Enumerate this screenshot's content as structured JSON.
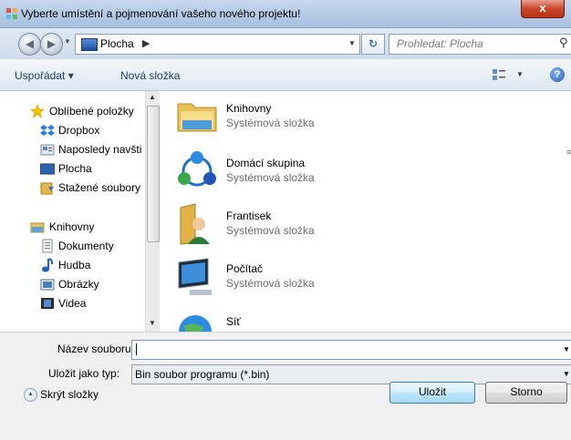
{
  "window": {
    "title": "Vyberte umístění a pojmenování vašeho nového projektu!",
    "close_label": "x"
  },
  "address": {
    "location": "Plocha",
    "search_placeholder": "Prohledat: Plocha"
  },
  "toolbar": {
    "organize_label": "Uspořádat ▾",
    "new_folder_label": "Nová složka"
  },
  "nav": {
    "favorites": [
      {
        "label": "Oblíbené položky",
        "icon": "star-icon"
      },
      {
        "label": "Dropbox",
        "icon": "dropbox-icon"
      },
      {
        "label": "Naposledy navšti",
        "icon": "recent-places-icon"
      },
      {
        "label": "Plocha",
        "icon": "desktop-icon"
      },
      {
        "label": "Stažené soubory",
        "icon": "downloads-icon"
      }
    ],
    "libraries": [
      {
        "label": "Knihovny",
        "icon": "libraries-icon"
      },
      {
        "label": "Dokumenty",
        "icon": "documents-icon"
      },
      {
        "label": "Hudba",
        "icon": "music-icon"
      },
      {
        "label": "Obrázky",
        "icon": "pictures-icon"
      },
      {
        "label": "Videa",
        "icon": "videos-icon"
      }
    ]
  },
  "content": {
    "items": [
      {
        "name": "Knihovny",
        "desc": "Systémová složka",
        "icon": "libraries-folder-icon"
      },
      {
        "name": "Domácí skupina",
        "desc": "Systémová složka",
        "icon": "homegroup-icon"
      },
      {
        "name": "Frantisek",
        "desc": "Systémová složka",
        "icon": "user-folder-icon"
      },
      {
        "name": "Počítač",
        "desc": "Systémová složka",
        "icon": "computer-icon"
      },
      {
        "name": "Síť",
        "desc": "",
        "icon": "network-icon"
      }
    ]
  },
  "form": {
    "filename_label": "Název souboru:",
    "filename_value": "",
    "filetype_label": "Uložit jako typ:",
    "filetype_value": "Bin soubor programu (*.bin)"
  },
  "footer": {
    "hide_folders_label": "Skrýt složky",
    "save_label": "Uložit",
    "cancel_label": "Storno"
  }
}
